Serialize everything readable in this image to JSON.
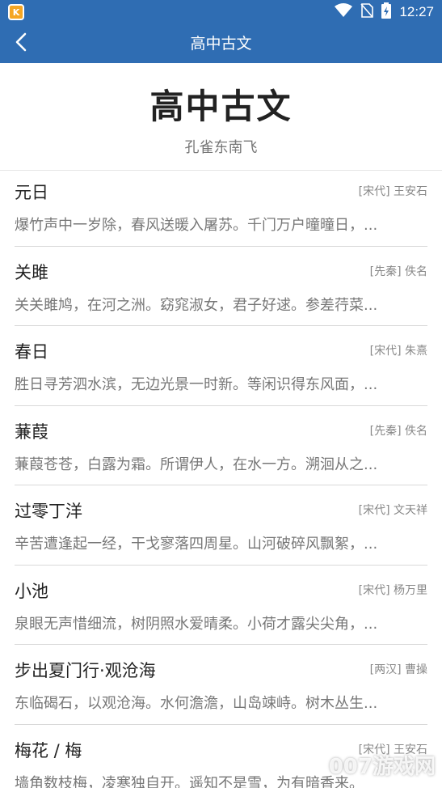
{
  "status_bar": {
    "time": "12:27",
    "app_icon_letter": "K",
    "icons": [
      "wifi-icon",
      "no-sim-icon",
      "battery-icon"
    ]
  },
  "app_bar": {
    "title": "高中古文",
    "back_icon": "back-arrow-icon"
  },
  "header": {
    "title": "高中古文",
    "subtitle": "孔雀东南飞"
  },
  "poems": [
    {
      "title": "元日",
      "meta": "[宋代] 王安石",
      "excerpt": "爆竹声中一岁除，春风送暖入屠苏。千门万户曈曈日，..."
    },
    {
      "title": "关雎",
      "meta": "[先秦] 佚名",
      "excerpt": "关关雎鸠，在河之洲。窈窕淑女，君子好逑。参差荇菜..."
    },
    {
      "title": "春日",
      "meta": "[宋代] 朱熹",
      "excerpt": "胜日寻芳泗水滨，无边光景一时新。等闲识得东风面，..."
    },
    {
      "title": "蒹葭",
      "meta": "[先秦] 佚名",
      "excerpt": "蒹葭苍苍，白露为霜。所谓伊人，在水一方。溯洄从之..."
    },
    {
      "title": "过零丁洋",
      "meta": "[宋代] 文天祥",
      "excerpt": "辛苦遭逢起一经，干戈寥落四周星。山河破碎风飘絮，..."
    },
    {
      "title": "小池",
      "meta": "[宋代] 杨万里",
      "excerpt": "泉眼无声惜细流，树阴照水爱晴柔。小荷才露尖尖角，..."
    },
    {
      "title": "步出夏门行·观沧海",
      "meta": "[两汉] 曹操",
      "excerpt": "东临碣石，以观沧海。水何澹澹，山岛竦峙。树木丛生..."
    },
    {
      "title": "梅花 / 梅",
      "meta": "[宋代] 王安石",
      "excerpt": "墙角数枝梅，凌寒独自开。遥知不是雪，为有暗香来。"
    }
  ],
  "watermark": "007游戏网"
}
